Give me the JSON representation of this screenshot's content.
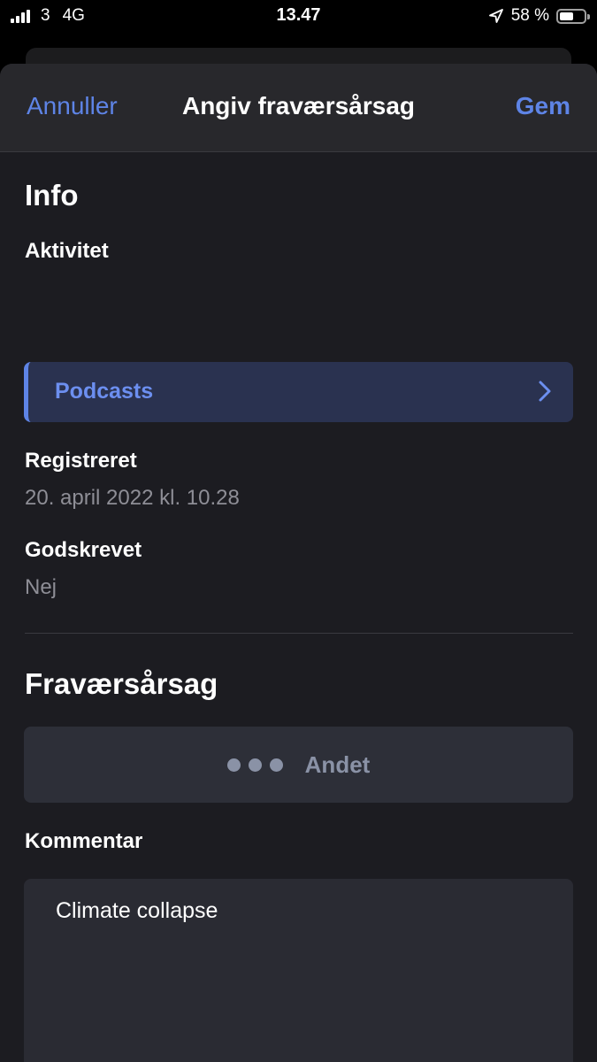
{
  "status_bar": {
    "carrier": "3",
    "network": "4G",
    "time": "13.47",
    "battery_percent": "58 %",
    "battery_level": 0.58,
    "signal_bars": 4
  },
  "nav": {
    "cancel_label": "Annuller",
    "title": "Angiv fraværsårsag",
    "save_label": "Gem"
  },
  "info": {
    "section_title": "Info",
    "activity_label": "Aktivitet",
    "activity_value": "Podcasts",
    "registered_label": "Registreret",
    "registered_value": "20. april 2022 kl. 10.28",
    "approved_label": "Godskrevet",
    "approved_value": "Nej"
  },
  "reason": {
    "section_title": "Fraværsårsag",
    "selected_label": "Andet",
    "icon": "ellipsis-icon"
  },
  "comment": {
    "label": "Kommentar",
    "value": "Climate collapse"
  },
  "colors": {
    "accent": "#5e84e6",
    "sheet_background": "#1c1c21",
    "nav_background": "#28282c",
    "activity_background": "#2a3250",
    "muted_text": "#8e8e96"
  }
}
